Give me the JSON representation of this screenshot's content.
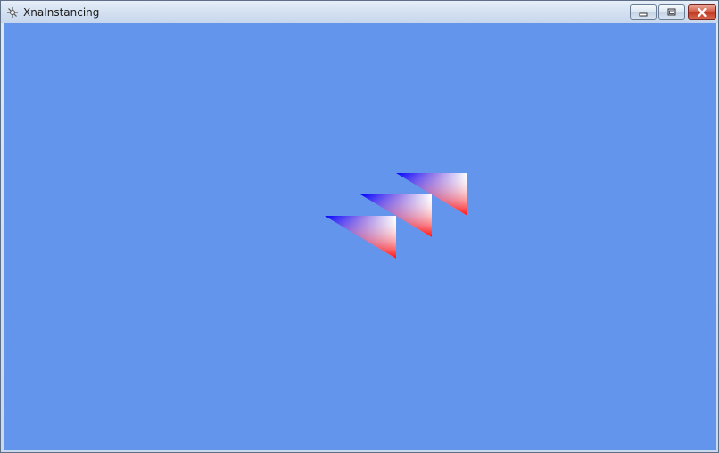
{
  "window": {
    "title": "XnaInstancing",
    "app_icon": "xna-app-icon",
    "controls": {
      "minimize_icon": "minimize-icon",
      "maximize_icon": "maximize-icon",
      "close_icon": "close-icon"
    }
  },
  "scene": {
    "background_color": "#6495ED",
    "instance_count": 3,
    "vertex_colors": [
      "#0000FF",
      "#FFFFFF",
      "#FF0000"
    ]
  }
}
